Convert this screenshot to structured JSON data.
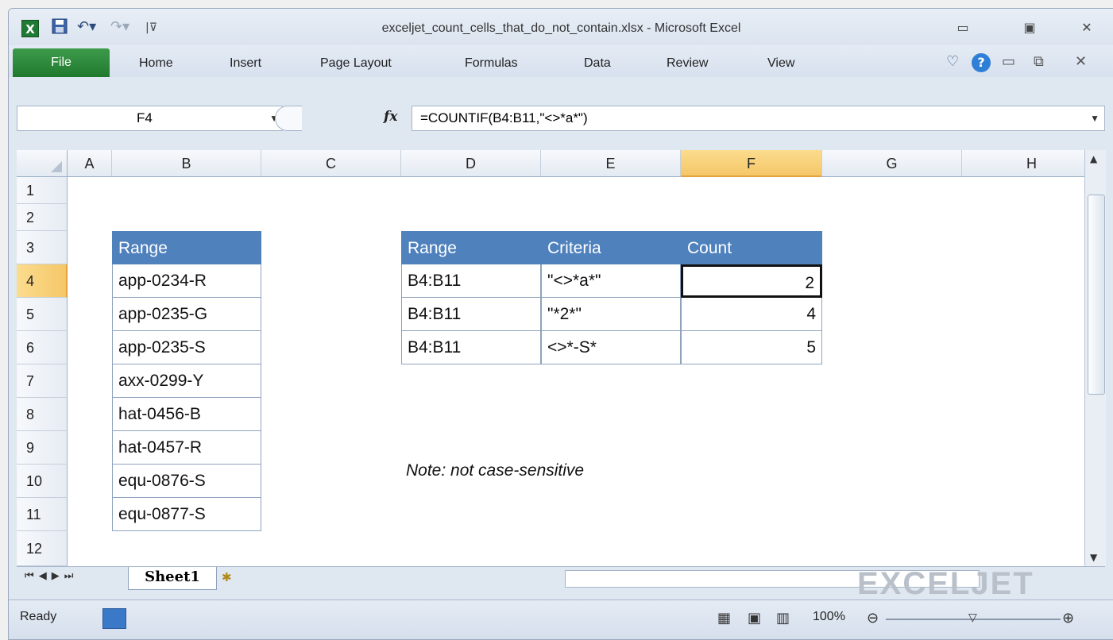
{
  "window": {
    "title": "exceljet_count_cells_that_do_not_contain.xlsx - Microsoft Excel",
    "app_icon": "X"
  },
  "ribbon": {
    "file_label": "File",
    "tabs": [
      "Home",
      "Insert",
      "Page Layout",
      "Formulas",
      "Data",
      "Review",
      "View"
    ]
  },
  "formula_bar": {
    "name_box": "F4",
    "fx_label": "fx",
    "formula": "=COUNTIF(B4:B11,\"<>*a*\")"
  },
  "columns": [
    "A",
    "B",
    "C",
    "D",
    "E",
    "F",
    "G",
    "H"
  ],
  "rows": [
    "1",
    "2",
    "3",
    "4",
    "5",
    "6",
    "7",
    "8",
    "9",
    "10",
    "11",
    "12"
  ],
  "range_table": {
    "header": "Range",
    "values": [
      "app-0234-R",
      "app-0235-G",
      "app-0235-S",
      "axx-0299-Y",
      "hat-0456-B",
      "hat-0457-R",
      "equ-0876-S",
      "equ-0877-S"
    ]
  },
  "summary_table": {
    "headers": [
      "Range",
      "Criteria",
      "Count"
    ],
    "rows": [
      {
        "range": "B4:B11",
        "criteria": "\"<>*a*\"",
        "count": "2"
      },
      {
        "range": "B4:B11",
        "criteria": "\"*2*\"",
        "count": "4"
      },
      {
        "range": "B4:B11",
        "criteria": "<>*-S*",
        "count": "5"
      }
    ]
  },
  "note": "Note: not case-sensitive",
  "sheet_tab": "Sheet1",
  "status": {
    "ready": "Ready",
    "zoom": "100%"
  },
  "watermark": "EXCELJET",
  "colors": {
    "header_fill": "#4f81bd",
    "file_tab": "#2a8a38",
    "selected_header": "#f5c768"
  }
}
